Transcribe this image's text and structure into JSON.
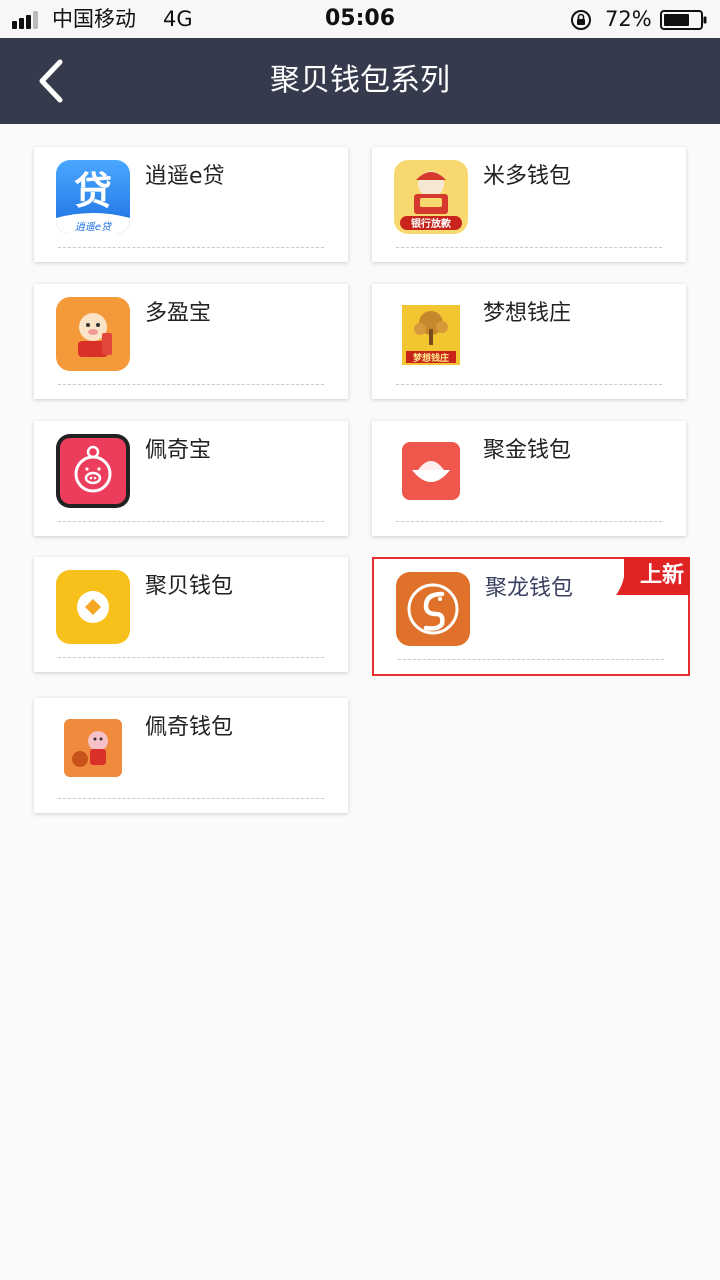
{
  "status_bar": {
    "carrier": "中国移动",
    "network": "4G",
    "time": "05:06",
    "battery_percent": "72%",
    "battery_level": 0.72
  },
  "nav": {
    "title": "聚贝钱包系列",
    "back_icon": "chevron-left-icon"
  },
  "apps": [
    {
      "name": "逍遥e贷",
      "icon": "xiaoyao-e-dai-logo",
      "icon_text": "贷",
      "icon_subtext": "逍遥e贷",
      "color": "#2f8bf0"
    },
    {
      "name": "米多钱包",
      "icon": "miduo-wallet-logo",
      "icon_text": "银行放款",
      "color": "#f4c74c"
    },
    {
      "name": "多盈宝",
      "icon": "duoyingbao-logo",
      "color": "#f49a3b"
    },
    {
      "name": "梦想钱庄",
      "icon": "mengxiang-qianzhuang-logo",
      "icon_text": "梦想钱庄",
      "color": "#f2c531"
    },
    {
      "name": "佩奇宝",
      "icon": "peiqibao-pig-logo",
      "color": "#ec3d5c"
    },
    {
      "name": "聚金钱包",
      "icon": "jujin-wallet-logo",
      "color": "#f0574c"
    },
    {
      "name": "聚贝钱包",
      "icon": "jubei-wallet-logo",
      "color": "#f7c01a"
    },
    {
      "name": "聚龙钱包",
      "icon": "julong-dragon-logo",
      "color": "#e0712b",
      "badge": "上新"
    },
    {
      "name": "佩奇钱包",
      "icon": "peiqi-wallet-logo",
      "color": "#f08a3c"
    }
  ],
  "colors": {
    "nav_background": "#353b4d",
    "highlight_border": "#e52e2e",
    "badge": "#e02424"
  }
}
